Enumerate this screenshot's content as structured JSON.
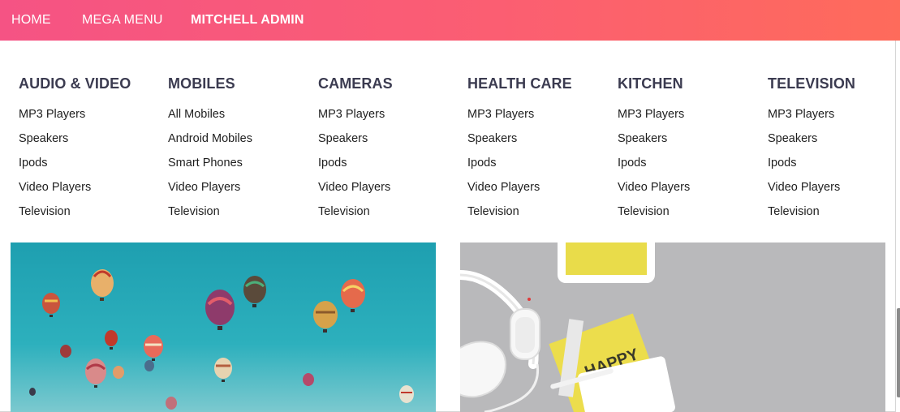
{
  "navbar": {
    "gradient_start": "#f55384",
    "gradient_end": "#fe6b5b",
    "items": [
      {
        "label": "HOME"
      },
      {
        "label": "MEGA MENU"
      },
      {
        "label": "MITCHELL ADMIN"
      }
    ]
  },
  "mega_menu": {
    "columns": [
      {
        "title": "AUDIO & VIDEO",
        "links": [
          "MP3 Players",
          "Speakers",
          "Ipods",
          "Video Players",
          "Television"
        ]
      },
      {
        "title": "MOBILES",
        "links": [
          "All Mobiles",
          "Android Mobiles",
          "Smart Phones",
          "Video Players",
          "Television"
        ]
      },
      {
        "title": "CAMERAS",
        "links": [
          "MP3 Players",
          "Speakers",
          "Ipods",
          "Video Players",
          "Television"
        ]
      },
      {
        "title": "HEALTH CARE",
        "links": [
          "MP3 Players",
          "Speakers",
          "Ipods",
          "Video Players",
          "Television"
        ]
      },
      {
        "title": "KITCHEN",
        "links": [
          "MP3 Players",
          "Speakers",
          "Ipods",
          "Video Players",
          "Television"
        ]
      },
      {
        "title": "TELEVISION",
        "links": [
          "MP3 Players",
          "Speakers",
          "Ipods",
          "Video Players",
          "Television"
        ]
      }
    ],
    "images": [
      {
        "subject": "hot-air-balloons-sky",
        "sky_color": "#26a6b4"
      },
      {
        "subject": "headphones-flatlay",
        "bg_color": "#b9b9bb",
        "card_text": "HAPPY"
      }
    ]
  }
}
